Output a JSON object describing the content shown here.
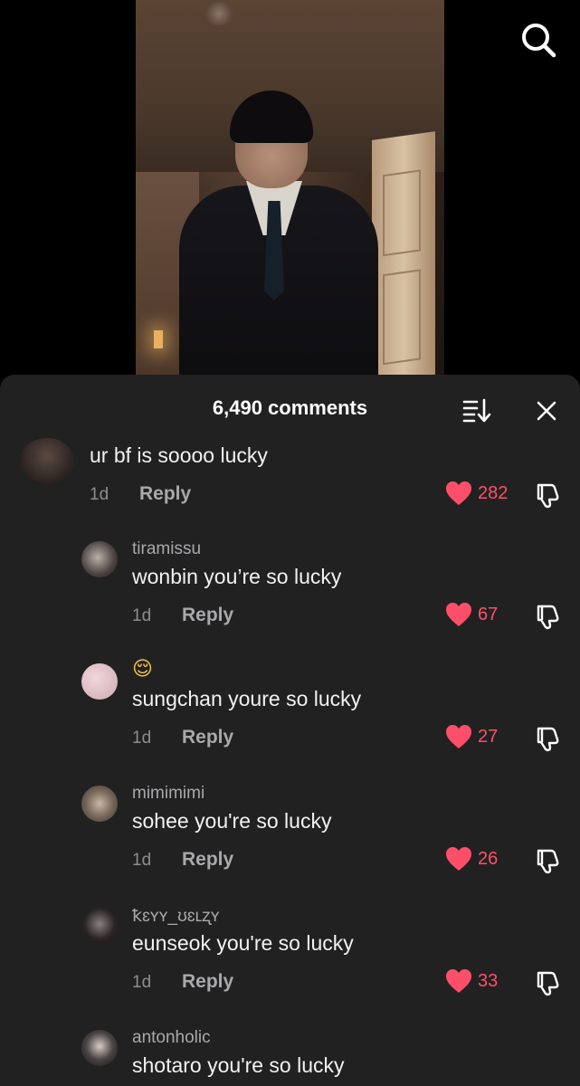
{
  "header": {
    "comment_count": "6,490 comments"
  },
  "icons": {
    "search": "search-icon",
    "sort": "sort-icon",
    "close": "close-icon",
    "like": "heart-icon",
    "dislike": "thumbs-down-icon"
  },
  "colors": {
    "sheet_bg": "#222122",
    "like": "#fe4f6a",
    "muted_text": "#a8a8ab"
  },
  "comments": [
    {
      "username": "",
      "text": "ur bf is soooo lucky",
      "time": "1d",
      "reply_label": "Reply",
      "likes": "282",
      "liked": true
    },
    {
      "username": "tiramissu",
      "text": "wonbin you’re so lucky",
      "time": "1d",
      "reply_label": "Reply",
      "likes": "67",
      "liked": true
    },
    {
      "username": "😌",
      "text": "sungchan youre so lucky",
      "time": "1d",
      "reply_label": "Reply",
      "likes": "27",
      "liked": true
    },
    {
      "username": "mimimimi",
      "text": "sohee you're so lucky",
      "time": "1d",
      "reply_label": "Reply",
      "likes": "26",
      "liked": true
    },
    {
      "username": "ꝁɛʏʏ_ʊɛʟʐʏ",
      "text": "eunseok you're so lucky",
      "time": "1d",
      "reply_label": "Reply",
      "likes": "33",
      "liked": true
    },
    {
      "username": "antonholic",
      "text": "shotaro you're so lucky"
    }
  ]
}
